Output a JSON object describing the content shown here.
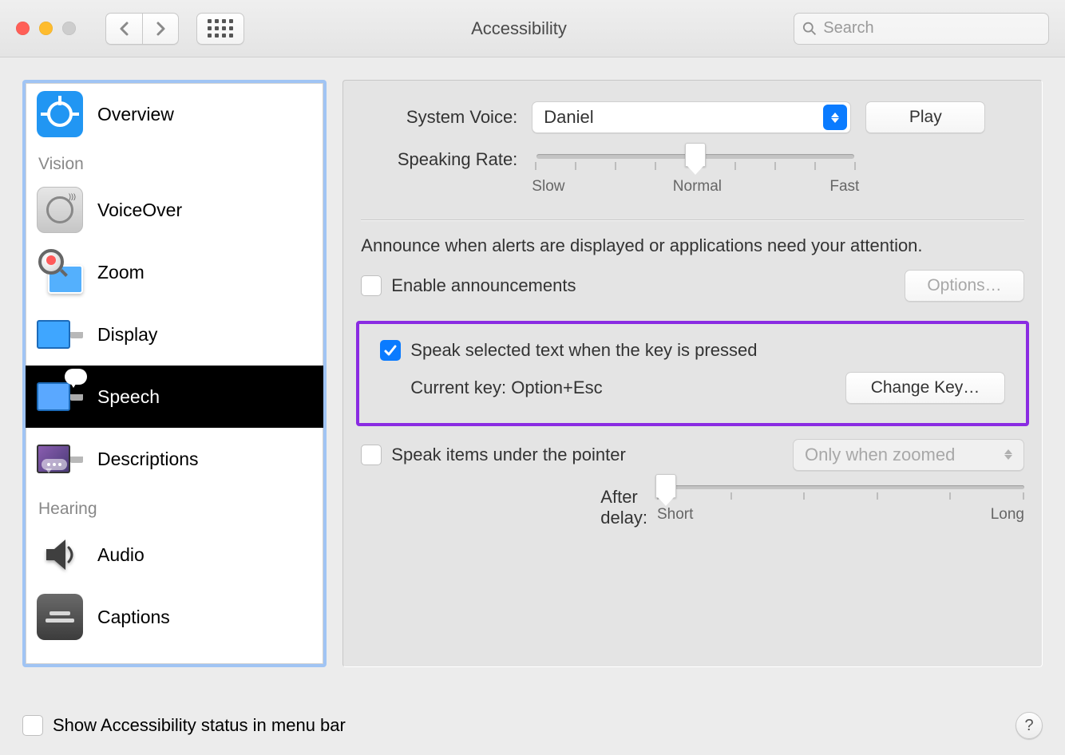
{
  "window": {
    "title": "Accessibility",
    "search_placeholder": "Search"
  },
  "sidebar": {
    "items": [
      {
        "label": "Overview"
      },
      {
        "header": "Vision"
      },
      {
        "label": "VoiceOver"
      },
      {
        "label": "Zoom"
      },
      {
        "label": "Display"
      },
      {
        "label": "Speech",
        "selected": true
      },
      {
        "label": "Descriptions"
      },
      {
        "header": "Hearing"
      },
      {
        "label": "Audio"
      },
      {
        "label": "Captions"
      }
    ]
  },
  "panel": {
    "system_voice_label": "System Voice:",
    "system_voice_value": "Daniel",
    "play_label": "Play",
    "speaking_rate_label": "Speaking Rate:",
    "rate_labels": {
      "slow": "Slow",
      "normal": "Normal",
      "fast": "Fast"
    },
    "announce_text": "Announce when alerts are displayed or applications need your attention.",
    "enable_announcements_label": "Enable announcements",
    "options_label": "Options…",
    "speak_selected_label": "Speak selected text when the key is pressed",
    "current_key_label": "Current key: Option+Esc",
    "change_key_label": "Change Key…",
    "speak_pointer_label": "Speak items under the pointer",
    "pointer_mode_value": "Only when zoomed",
    "after_delay_label": "After delay:",
    "delay_labels": {
      "short": "Short",
      "long": "Long"
    }
  },
  "footer": {
    "show_status_label": "Show Accessibility status in menu bar",
    "help": "?"
  }
}
